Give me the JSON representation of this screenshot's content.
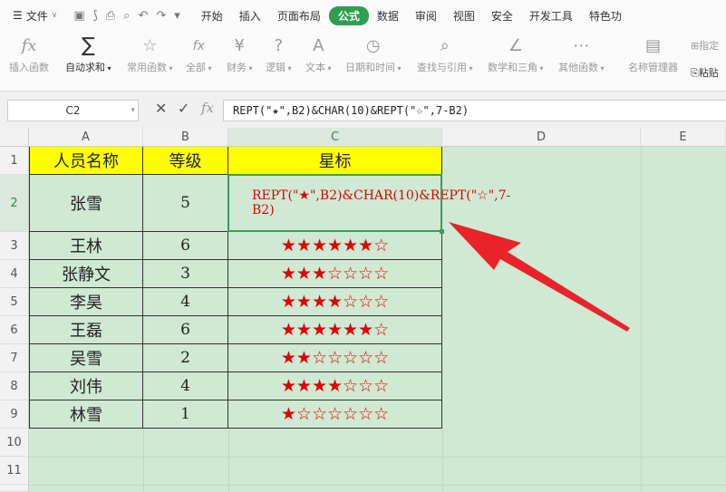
{
  "menubar": {
    "file_label": "文件",
    "tabs": [
      "开始",
      "插入",
      "页面布局",
      "公式",
      "数据",
      "审阅",
      "视图",
      "安全",
      "开发工具",
      "特色功"
    ],
    "active_tab": "公式"
  },
  "ribbon": {
    "items": [
      "插入函数",
      "自动求和",
      "常用函数",
      "全部",
      "财务",
      "逻辑",
      "文本",
      "日期和时间",
      "查找与引用",
      "数学和三角",
      "其他函数",
      "名称管理器",
      "粘贴",
      "指定"
    ]
  },
  "formula_bar": {
    "cell_ref": "C2",
    "fx_label": "fx",
    "formula": "REPT(\"★\",B2)&CHAR(10)&REPT(\"☆\",7-B2)"
  },
  "columns": [
    "A",
    "B",
    "C",
    "D",
    "E"
  ],
  "rows": [
    "1",
    "2",
    "3",
    "4",
    "5",
    "6",
    "7",
    "8",
    "9",
    "10",
    "11"
  ],
  "table": {
    "headers": [
      "人员名称",
      "等级",
      "星标"
    ],
    "rows": [
      {
        "name": "张雪",
        "level": "5",
        "stars": "REPT(\"★\",B2)&CHAR(10)&REPT(\"☆\",7-B2)"
      },
      {
        "name": "王林",
        "level": "6",
        "stars": "★★★★★★☆"
      },
      {
        "name": "张静文",
        "level": "3",
        "stars": "★★★☆☆☆☆"
      },
      {
        "name": "李昊",
        "level": "4",
        "stars": "★★★★☆☆☆"
      },
      {
        "name": "王磊",
        "level": "6",
        "stars": "★★★★★★☆"
      },
      {
        "name": "吴雪",
        "level": "2",
        "stars": "★★☆☆☆☆☆"
      },
      {
        "name": "刘伟",
        "level": "4",
        "stars": "★★★★☆☆☆"
      },
      {
        "name": "林雪",
        "level": "1",
        "stars": "★☆☆☆☆☆☆"
      }
    ]
  },
  "colors": {
    "accent": "#2e9e4f",
    "header_fill": "#ffff00",
    "star_red": "#e00000",
    "sheet_bg": "#cfe9d3",
    "arrow": "#e8232a"
  }
}
